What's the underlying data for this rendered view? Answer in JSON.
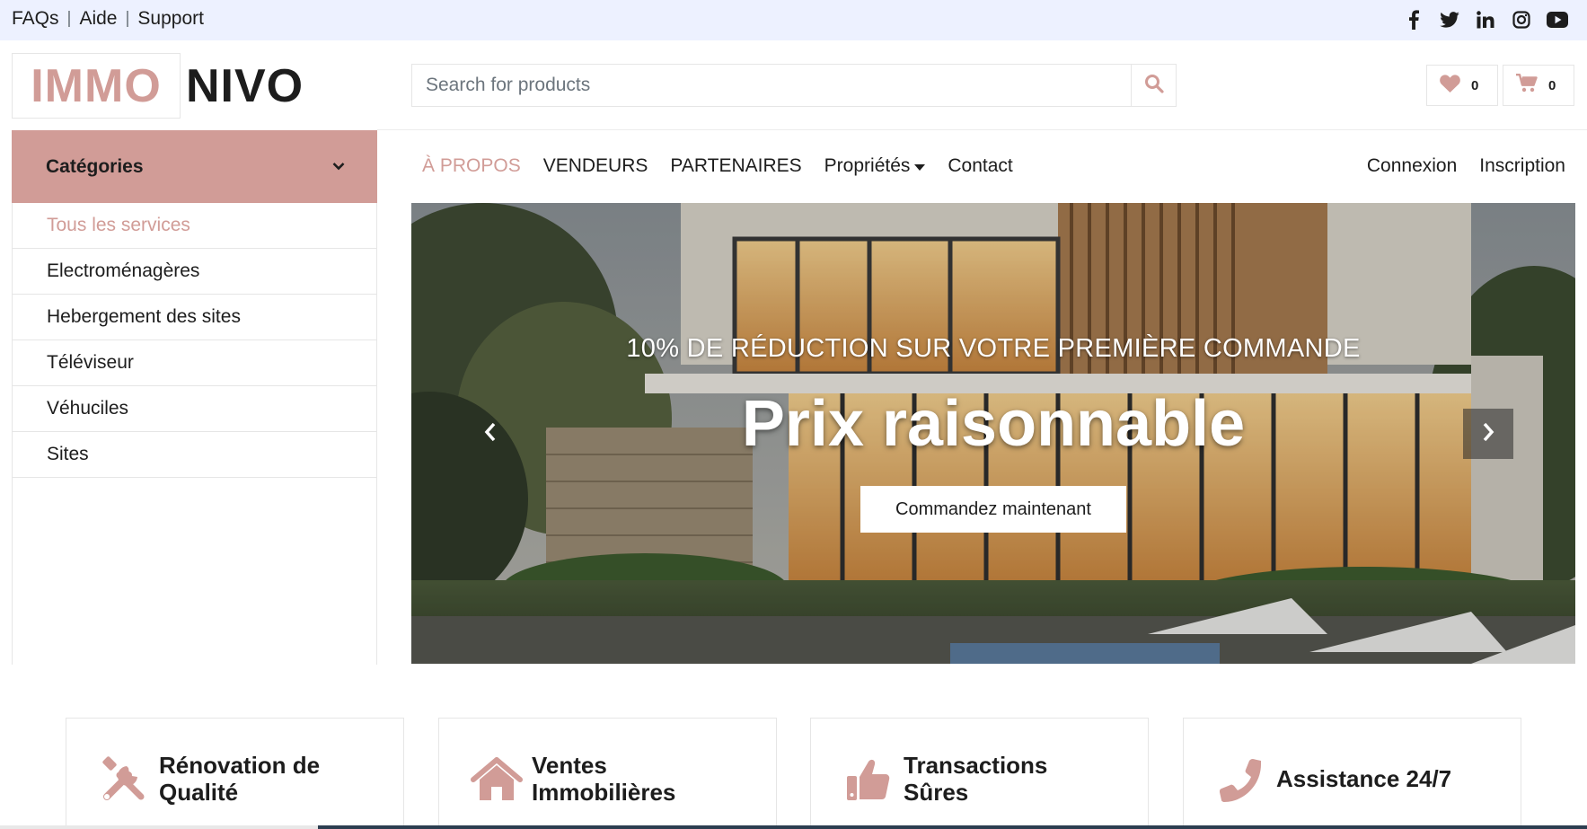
{
  "topbar": {
    "links": [
      "FAQs",
      "Aide",
      "Support"
    ],
    "separator": "|",
    "social": [
      "facebook-icon",
      "twitter-icon",
      "linkedin-icon",
      "instagram-icon",
      "youtube-icon"
    ],
    "background": "#edf1ff"
  },
  "logo": {
    "part1": "IMMO",
    "part2": "NIVO"
  },
  "search": {
    "placeholder": "Search for products",
    "icon": "search-icon"
  },
  "header": {
    "wishlist": {
      "icon": "heart-icon",
      "count": "0"
    },
    "cart": {
      "icon": "cart-icon",
      "count": "0"
    }
  },
  "sidebar": {
    "title": "Catégories",
    "items": [
      {
        "label": "Tous les services",
        "active": true
      },
      {
        "label": "Electroménagères",
        "active": false
      },
      {
        "label": "Hebergement des sites",
        "active": false
      },
      {
        "label": "Téléviseur",
        "active": false
      },
      {
        "label": "Véhuciles",
        "active": false
      },
      {
        "label": "Sites",
        "active": false
      }
    ]
  },
  "nav": {
    "items": [
      "À PROPOS",
      "VENDEURS",
      "PARTENAIRES",
      "Propriétés",
      "Contact"
    ],
    "login": "Connexion",
    "register": "Inscription"
  },
  "hero": {
    "subtitle": "10% DE RÉDUCTION SUR VOTRE PREMIÈRE COMMANDE",
    "title": "Prix raisonnable",
    "cta": "Commandez maintenant"
  },
  "features": [
    {
      "icon": "tools-icon",
      "label": "Rénovation de Qualité"
    },
    {
      "icon": "home-icon",
      "label": "Ventes Immobilières"
    },
    {
      "icon": "thumbs-up-icon",
      "label": "Transactions Sûres"
    },
    {
      "icon": "phone-icon",
      "label": "Assistance 24/7"
    }
  ],
  "colors": {
    "primary": "#d19c97",
    "dark": "#1d1d1d",
    "topbar": "#edf1ff",
    "border": "#e6e6e6"
  }
}
